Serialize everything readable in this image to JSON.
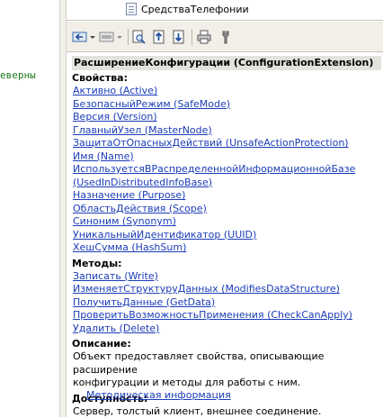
{
  "left_pane": {
    "code_fragment": "еверны"
  },
  "tree": {
    "item_label": "СредстваТелефонии"
  },
  "toolbar": {
    "buttons": [
      "back-icon",
      "forward-icon",
      "find-icon",
      "go-up-icon",
      "sync-icon",
      "print-icon",
      "settings-icon"
    ]
  },
  "help": {
    "title": "РасширениеКонфигурации (ConfigurationExtension)",
    "properties_label": "Свойства:",
    "properties": [
      "Активно (Active)",
      "БезопасныйРежим (SafeMode)",
      "Версия (Version)",
      "ГлавныйУзел (MasterNode)",
      "ЗащитаОтОпасныхДействий (UnsafeActionProtection)",
      "Имя (Name)",
      "ИспользуетсяВРаспределеннойИнформационнойБазе",
      "(UsedInDistributedInfoBase)",
      "Назначение (Purpose)",
      "ОбластьДействия (Scope)",
      "Синоним (Synonym)",
      "УникальныйИдентификатор (UUID)",
      "ХешСумма (HashSum)"
    ],
    "methods_label": "Методы:",
    "methods": [
      "Записать (Write)",
      "ИзменяетСтруктуруДанных (ModifiesDataStructure)",
      "ПолучитьДанные (GetData)",
      "ПроверитьВозможностьПрименения (CheckCanApply)",
      "Удалить (Delete)"
    ],
    "description_label": "Описание:",
    "description_lines": [
      "Объект предоставляет свойства, описывающие расширение",
      "конфигурации и методы для работы с ним."
    ],
    "availability_label": "Доступность:",
    "availability_text": "Сервер, толстый клиент, внешнее соединение.",
    "method_info_link": "Методическая информация"
  }
}
